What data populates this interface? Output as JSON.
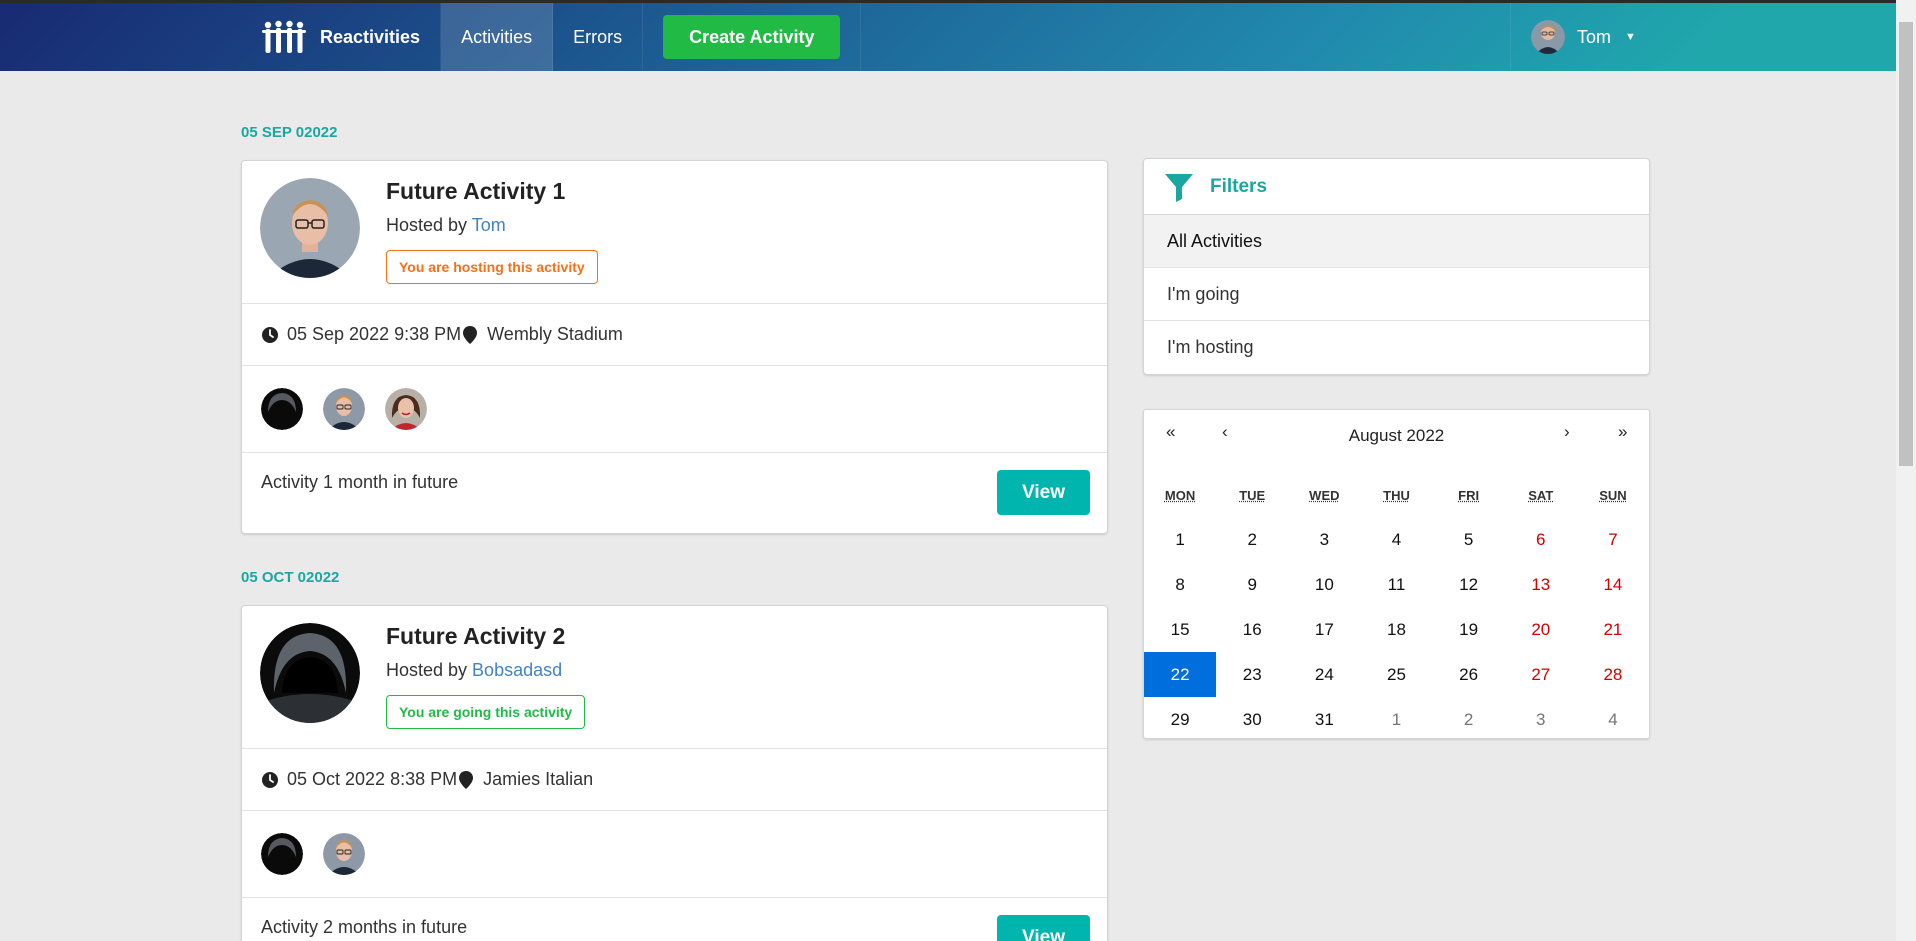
{
  "nav": {
    "brand": "Reactivities",
    "activities": "Activities",
    "errors": "Errors",
    "create": "Create Activity",
    "user": "Tom"
  },
  "activities": [
    {
      "date_header": "05 SEP 02022",
      "title": "Future Activity 1",
      "hosted_prefix": "Hosted by ",
      "host": "Tom",
      "badge": "You are hosting this activity",
      "datetime": "05 Sep 2022 9:38 PM",
      "venue": "Wembly Stadium",
      "description": "Activity 1 month in future",
      "view": "View"
    },
    {
      "date_header": "05 OCT 02022",
      "title": "Future Activity 2",
      "hosted_prefix": "Hosted by ",
      "host": "Bobsadasd",
      "badge": "You are going this activity",
      "datetime": "05 Oct 2022 8:38 PM",
      "venue": "Jamies Italian",
      "description": "Activity 2 months in future",
      "view": "View"
    }
  ],
  "filters": {
    "title": "Filters",
    "items": [
      "All Activities",
      "I'm going",
      "I'm hosting"
    ]
  },
  "calendar": {
    "month_label": "August 2022",
    "prev2": "«",
    "prev": "‹",
    "next": "›",
    "next2": "»",
    "weekdays": [
      "MON",
      "TUE",
      "WED",
      "THU",
      "FRI",
      "SAT",
      "SUN"
    ],
    "days": [
      "1",
      "2",
      "3",
      "4",
      "5",
      "6",
      "7",
      "8",
      "9",
      "10",
      "11",
      "12",
      "13",
      "14",
      "15",
      "16",
      "17",
      "18",
      "19",
      "20",
      "21",
      "22",
      "23",
      "24",
      "25",
      "26",
      "27",
      "28",
      "29",
      "30",
      "31",
      "1",
      "2",
      "3",
      "4"
    ],
    "selected": "22"
  },
  "colors": {
    "accent": "#00b5ad",
    "create_button": "#21ba45",
    "hosting_badge": "#f2711c",
    "going_badge": "#21ba45",
    "calendar_selected": "#006edc",
    "weekend": "#d10000"
  }
}
